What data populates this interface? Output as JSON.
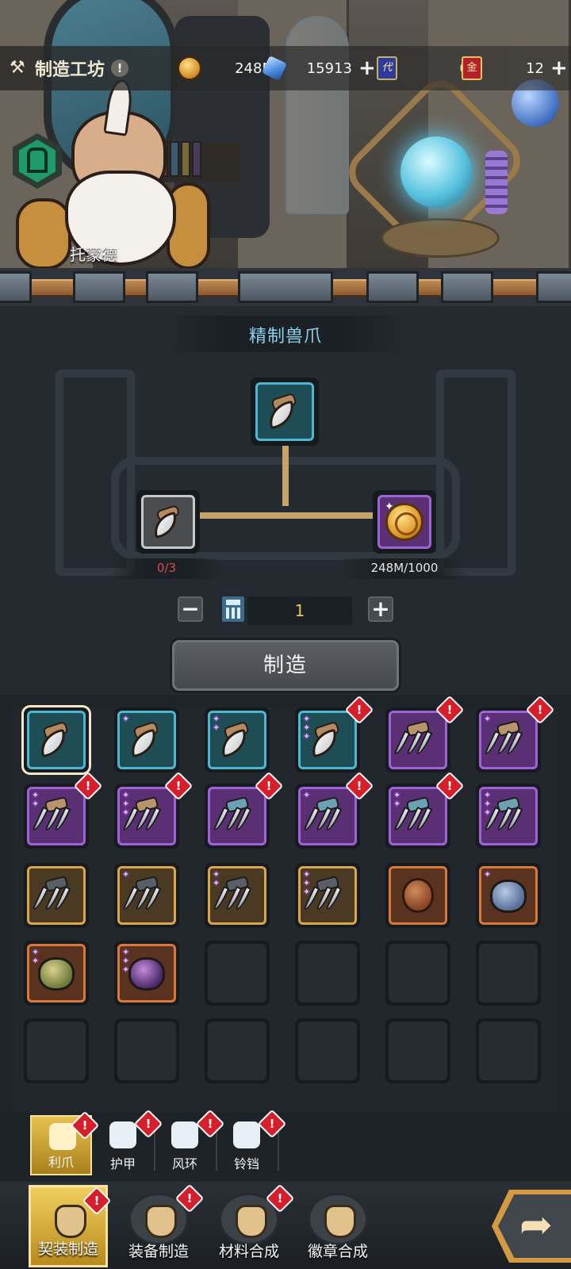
{
  "header": {
    "title": "制造工坊",
    "title_icon": "workshop-icon",
    "info_icon": "exclamation-icon",
    "info_mark": "!",
    "resources": [
      {
        "icon": "coin-icon",
        "value": "248M",
        "has_plus": false
      },
      {
        "icon": "crystal-icon",
        "value": "15913",
        "has_plus": true
      },
      {
        "icon": "ticket-icon",
        "icon_text": "代",
        "value": "0",
        "has_plus": false
      },
      {
        "icon": "red-card-icon",
        "icon_text": "金",
        "value": "12",
        "has_plus": true
      }
    ],
    "plus_glyph": "+"
  },
  "npc": {
    "name": "托蒙德"
  },
  "recipe": {
    "title": "精制兽爪",
    "ingredient_count": "0/3",
    "gold_count": "248M/1000",
    "quantity": "1",
    "minus": "−",
    "plus": "+",
    "craft_label": "制造",
    "colors": {
      "insufficient": "#e24a4a",
      "sufficient": "#e6e6e6",
      "title": "#8fd0f2"
    }
  },
  "grid": {
    "rows": [
      [
        {
          "kind": "claw",
          "frame": "cyan",
          "stars": 0,
          "alert": false,
          "selected": true
        },
        {
          "kind": "claw",
          "frame": "cyan",
          "stars": 1,
          "alert": false
        },
        {
          "kind": "claw",
          "frame": "cyan",
          "stars": 2,
          "alert": false
        },
        {
          "kind": "claw",
          "frame": "cyan",
          "stars": 3,
          "alert": true
        },
        {
          "kind": "triclaw-tan",
          "frame": "purple",
          "stars": 0,
          "alert": true
        },
        {
          "kind": "triclaw-tan",
          "frame": "purple",
          "stars": 1,
          "alert": true
        }
      ],
      [
        {
          "kind": "triclaw-tan",
          "frame": "purple",
          "stars": 2,
          "alert": true
        },
        {
          "kind": "triclaw-tan",
          "frame": "purple",
          "stars": 3,
          "alert": true
        },
        {
          "kind": "triclaw-blue",
          "frame": "purple",
          "stars": 0,
          "alert": true
        },
        {
          "kind": "triclaw-blue",
          "frame": "purple",
          "stars": 1,
          "alert": true
        },
        {
          "kind": "triclaw-blue",
          "frame": "purple",
          "stars": 2,
          "alert": true
        },
        {
          "kind": "triclaw-blue",
          "frame": "purple",
          "stars": 3,
          "alert": false
        }
      ],
      [
        {
          "kind": "triclaw-dark",
          "frame": "gold",
          "stars": 0,
          "alert": false
        },
        {
          "kind": "triclaw-dark",
          "frame": "gold",
          "stars": 1,
          "alert": false
        },
        {
          "kind": "triclaw-dark",
          "frame": "gold",
          "stars": 2,
          "alert": false
        },
        {
          "kind": "triclaw-dark",
          "frame": "gold",
          "stars": 3,
          "alert": false
        },
        {
          "kind": "beetle",
          "frame": "orange",
          "stars": 0,
          "alert": false
        },
        {
          "kind": "critter-blue",
          "frame": "orange",
          "stars": 1,
          "alert": false
        }
      ],
      [
        {
          "kind": "critter-green",
          "frame": "orange",
          "stars": 2,
          "alert": false
        },
        {
          "kind": "critter-purple",
          "frame": "orange",
          "stars": 3,
          "alert": false
        },
        {
          "kind": "empty"
        },
        {
          "kind": "empty"
        },
        {
          "kind": "empty"
        },
        {
          "kind": "empty"
        }
      ],
      [
        {
          "kind": "empty"
        },
        {
          "kind": "empty"
        },
        {
          "kind": "empty"
        },
        {
          "kind": "empty"
        },
        {
          "kind": "empty"
        },
        {
          "kind": "empty"
        }
      ]
    ],
    "alert_glyph": "!",
    "star_glyph": "✦"
  },
  "subtabs": [
    {
      "label": "利爪",
      "icon": "claw-icon",
      "active": true,
      "alert": true
    },
    {
      "label": "护甲",
      "icon": "armor-icon",
      "active": false,
      "alert": true
    },
    {
      "label": "风环",
      "icon": "ring-icon",
      "active": false,
      "alert": true
    },
    {
      "label": "铃铛",
      "icon": "bell-icon",
      "active": false,
      "alert": true
    }
  ],
  "bottomnav": [
    {
      "label": "契装制造",
      "icon": "paw-icon",
      "active": true,
      "alert": true
    },
    {
      "label": "装备制造",
      "icon": "helmet-icon",
      "active": false,
      "alert": true
    },
    {
      "label": "材料合成",
      "icon": "crystal-shard-icon",
      "active": false,
      "alert": true
    },
    {
      "label": "徽章合成",
      "icon": "badge-icon",
      "active": false,
      "alert": false
    }
  ],
  "next_arrow": "➦"
}
